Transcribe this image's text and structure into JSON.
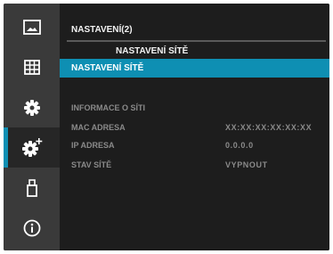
{
  "sidebar": {
    "items": [
      {
        "icon": "image-icon",
        "active": false
      },
      {
        "icon": "grid-icon",
        "active": false
      },
      {
        "icon": "gear-icon",
        "active": false
      },
      {
        "icon": "gear-plus-icon",
        "active": true
      },
      {
        "icon": "usb-icon",
        "active": false
      },
      {
        "icon": "info-icon",
        "active": false
      }
    ]
  },
  "header": {
    "title": "NASTAVENÍ(2)",
    "submenu": "NASTAVENÍ SÍTĚ"
  },
  "menu": {
    "selected_label": "NASTAVENÍ SÍTĚ"
  },
  "info": {
    "heading": "INFORMACE O SÍTI",
    "rows": [
      {
        "label": "MAC ADRESA",
        "value": "XX:XX:XX:XX:XX:XX"
      },
      {
        "label": "IP ADRESA",
        "value": "0.0.0.0"
      },
      {
        "label": "STAV SÍTĚ",
        "value": "VYPNOUT"
      }
    ]
  },
  "colors": {
    "accent": "#0e8fb3",
    "sidebar": "#3a3a3a",
    "background": "#1d1d1d"
  }
}
